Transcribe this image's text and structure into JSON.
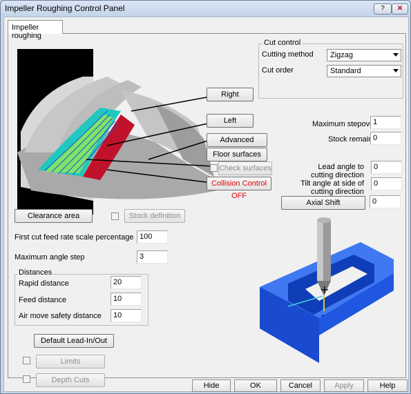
{
  "window": {
    "title": "Impeller Roughing Control Panel",
    "help_label": "?",
    "close_label": "✕"
  },
  "tab": {
    "label": "Impeller roughing"
  },
  "buttons": {
    "right": "Right",
    "left": "Left",
    "advanced": "Advanced",
    "floor_surfaces": "Floor surfaces",
    "check_surfaces": "Check surfaces",
    "collision_control": "Collision Control OFF",
    "axial_shift": "Axial Shift",
    "clearance_area": "Clearance area",
    "stock_definition": "Stock definition",
    "default_lead": "Default Lead-In/Out",
    "limits": "Limits",
    "depth_cuts": "Depth Cuts"
  },
  "cut_control": {
    "caption": "Cut control",
    "method_label": "Cutting method",
    "method_value": "Zigzag",
    "order_label": "Cut order",
    "order_value": "Standard"
  },
  "params": {
    "max_stepover_label": "Maximum stepover",
    "max_stepover": "1",
    "stock_remain_label": "Stock remain",
    "stock_remain": "0",
    "lead_angle_label": "Lead angle to cutting direction",
    "lead_angle": "0",
    "tilt_angle_label": "Tilt angle at side of cutting direction",
    "tilt_angle": "0",
    "axial_shift_value": "0",
    "first_cut_label": "First cut feed rate scale percentage",
    "first_cut": "100",
    "max_angle_label": "Maximum angle step",
    "max_angle": "3"
  },
  "distances": {
    "caption": "Distances",
    "rapid_label": "Rapid distance",
    "rapid": "20",
    "feed_label": "Feed distance",
    "feed": "10",
    "air_label": "Air move safety distance",
    "air": "10"
  },
  "footer": {
    "hide": "Hide",
    "ok": "OK",
    "cancel": "Cancel",
    "apply": "Apply",
    "help": "Help"
  },
  "colors": {
    "part_blue": "#1f57e0",
    "collision_red": "#e00000"
  }
}
